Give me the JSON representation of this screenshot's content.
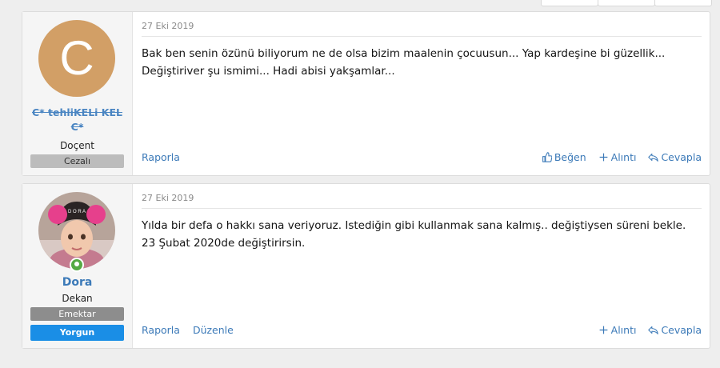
{
  "posts": [
    {
      "avatar_letter": "C",
      "username": "C* tehliKELi KEL C*",
      "user_title": "Doçent",
      "banners": [
        "Cezalı"
      ],
      "date": "27 Eki 2019",
      "body_lines": [
        "Bak ben senin özünü biliyorum ne de olsa bizim maalenin çocuusun... Yap kardeşine bi güzellik...",
        "Değiştiriver şu ismimi... Hadi abisi yakşamlar..."
      ],
      "footer_left": [
        "Raporla"
      ],
      "footer_right": [
        "Beğen",
        "Alıntı",
        "Cevapla"
      ]
    },
    {
      "username": "Dora",
      "user_title": "Dekan",
      "banners": [
        "Emektar",
        "Yorgun"
      ],
      "date": "27 Eki 2019",
      "body_lines": [
        "Yılda bir defa o hakkı sana veriyoruz. Istediğin gibi kullanmak sana kalmış.. değiştiysen süreni bekle.",
        "23 Şubat 2020de değiştirirsin."
      ],
      "footer_left": [
        "Raporla",
        "Düzenle"
      ],
      "footer_right": [
        "Alıntı",
        "Cevapla"
      ]
    }
  ],
  "colors": {
    "link": "#3c7ab8",
    "avatar_c": "#d29f66",
    "online": "#55aa44",
    "banner_blue": "#1a8ee6"
  }
}
